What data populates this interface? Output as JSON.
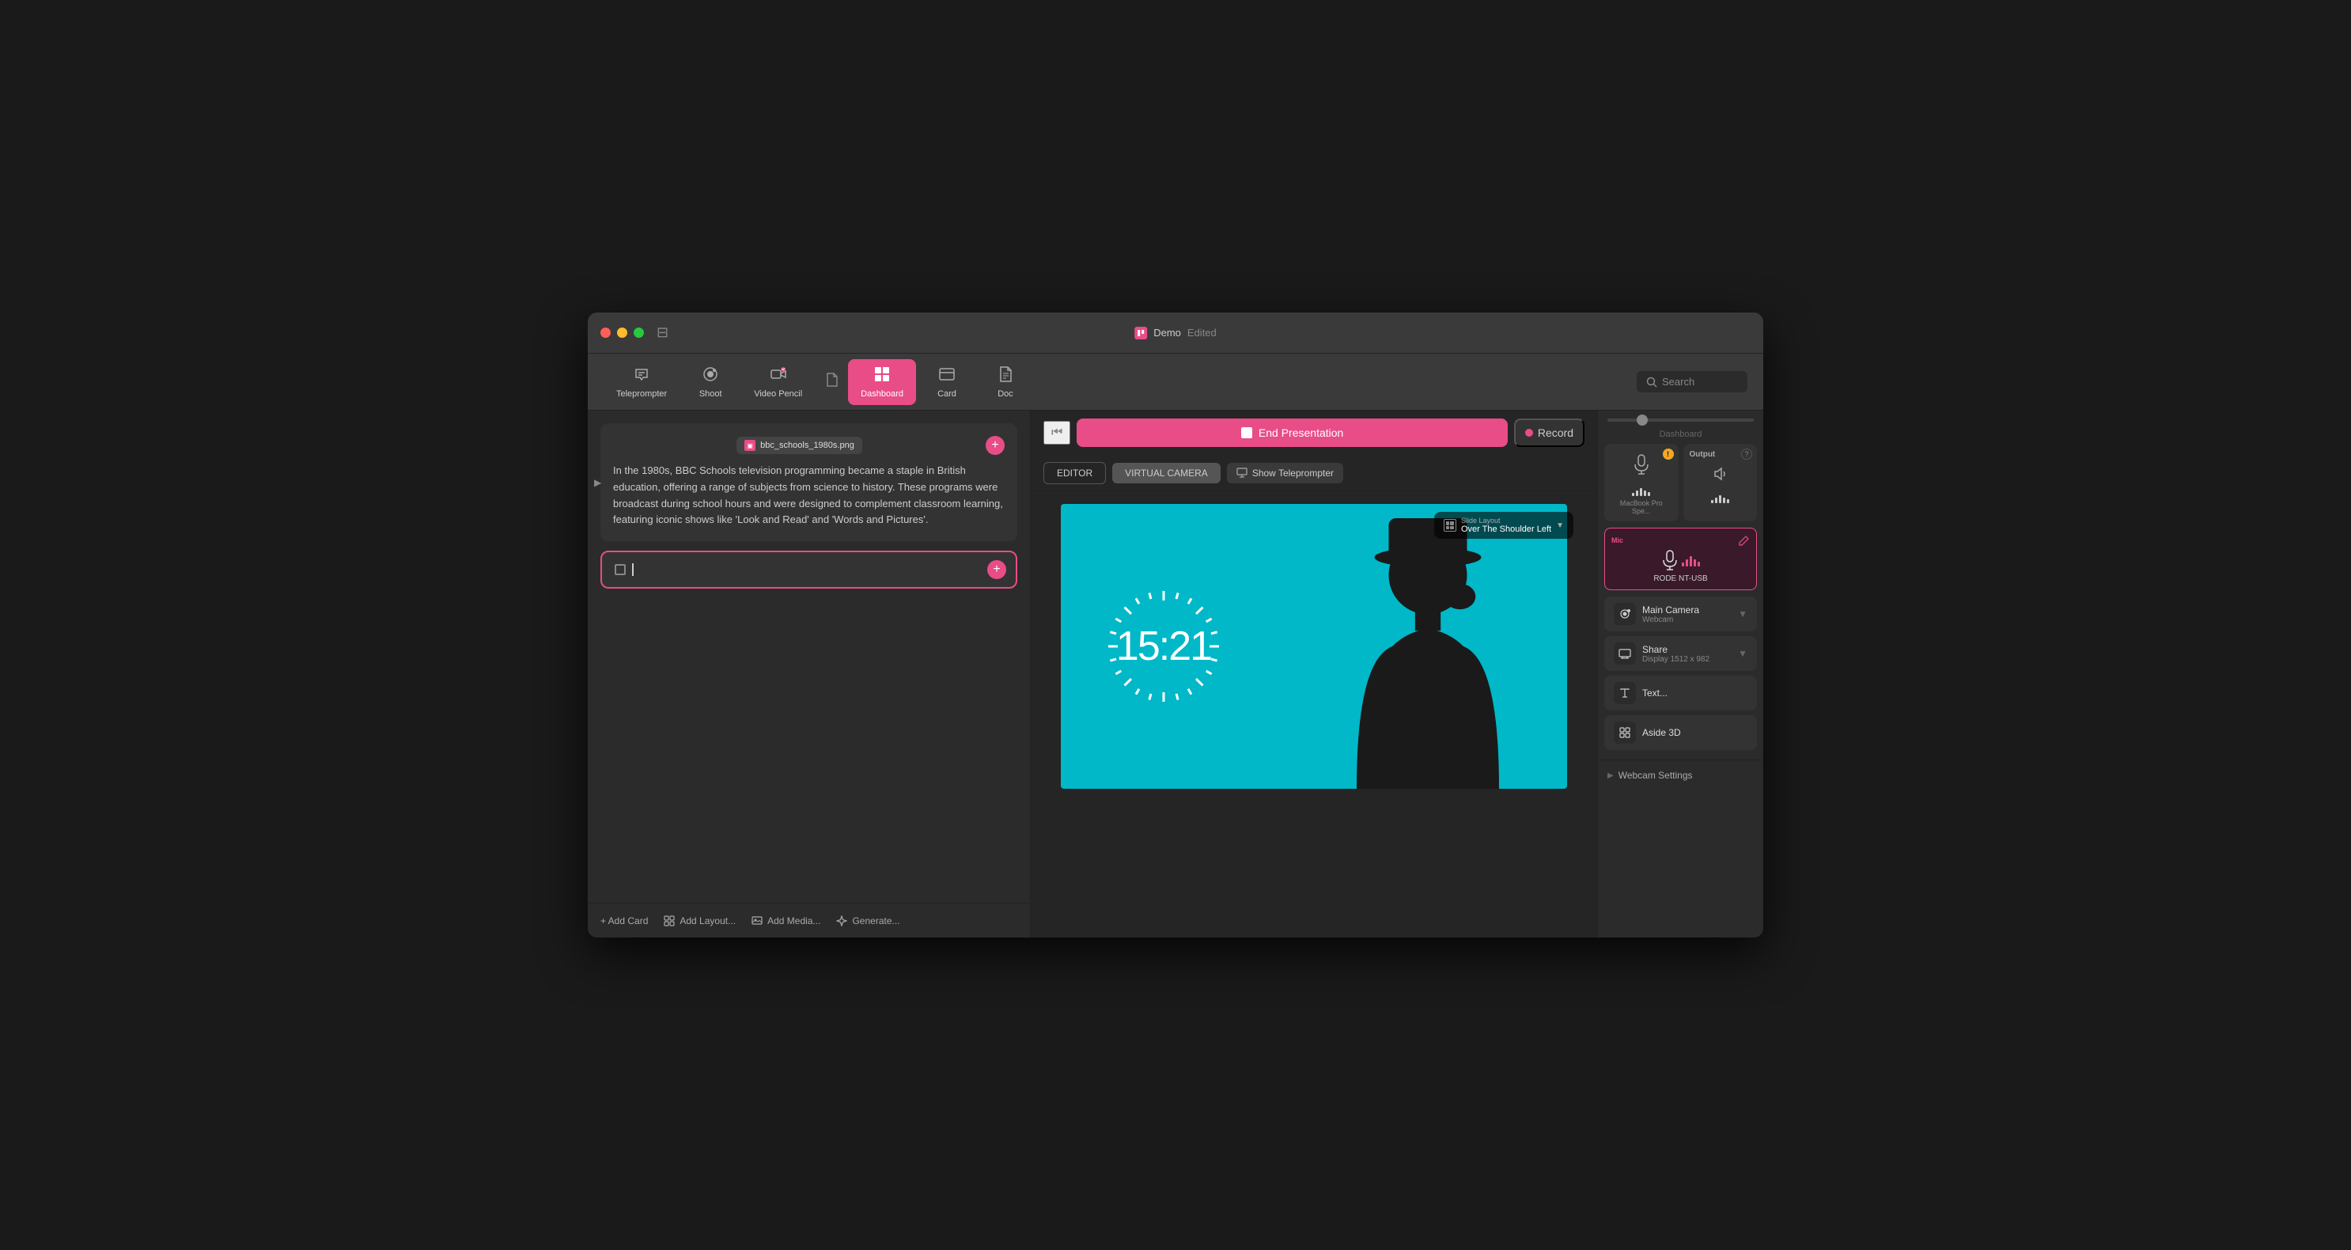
{
  "window": {
    "title": "Demo",
    "subtitle": "Edited"
  },
  "titlebar": {
    "controls": {
      "close": "×",
      "minimize": "−",
      "maximize": "+"
    },
    "sidebar_toggle": "⊟",
    "title": "Demo",
    "edited_label": "— Edited"
  },
  "toolbar": {
    "items": [
      {
        "id": "teleprompter",
        "label": "Teleprompter",
        "icon": "✎",
        "active": false
      },
      {
        "id": "shoot",
        "label": "Shoot",
        "icon": "⦿",
        "active": false
      },
      {
        "id": "video-pencil",
        "label": "Video Pencil",
        "icon": "✏",
        "active": false
      },
      {
        "id": "dashboard",
        "label": "Dashboard",
        "active": true
      },
      {
        "id": "card",
        "label": "Card",
        "active": false
      },
      {
        "id": "doc",
        "label": "Doc",
        "active": false
      }
    ],
    "search_placeholder": "Search"
  },
  "left_panel": {
    "card": {
      "file_badge": "bbc_schools_1980s.png",
      "text": "In the 1980s, BBC Schools television programming became a staple in British education, offering a range of subjects from science to history. These programs were broadcast during school hours and were designed to complement classroom learning, featuring iconic shows like 'Look and Read' and 'Words and Pictures'.",
      "add_label": "+"
    },
    "input_card": {
      "placeholder": "",
      "add_label": "+"
    },
    "bottom": {
      "add_card": "+ Add Card",
      "add_layout": "Add Layout...",
      "add_media": "Add Media...",
      "generate": "Generate..."
    }
  },
  "center_panel": {
    "pres_bar": {
      "end_label": "End Presentation",
      "record_label": "Record"
    },
    "tabs": {
      "editor": "EDITOR",
      "virtual_camera": "VIRTUAL CAMERA"
    },
    "teleprompter_btn": "Show Teleprompter",
    "slide_layout": {
      "label": "Slide Layout",
      "value": "Over The Shoulder Left"
    },
    "timer": "15:21"
  },
  "right_panel": {
    "section_label": "Dashboard",
    "devices": {
      "input_label": "MacBook Pro Spe...",
      "output_label": "Output"
    },
    "mic": {
      "label": "Mic",
      "name": "RODE NT-USB"
    },
    "rows": [
      {
        "id": "main-camera",
        "title": "Main Camera",
        "sub": "Webcam",
        "icon": "●"
      },
      {
        "id": "share",
        "title": "Share",
        "sub": "Display 1512 x 982",
        "icon": "▭"
      },
      {
        "id": "text",
        "title": "Text...",
        "icon": "A"
      },
      {
        "id": "aside-3d",
        "title": "Aside 3D",
        "icon": "⊞"
      }
    ],
    "webcam_settings": "Webcam Settings"
  }
}
